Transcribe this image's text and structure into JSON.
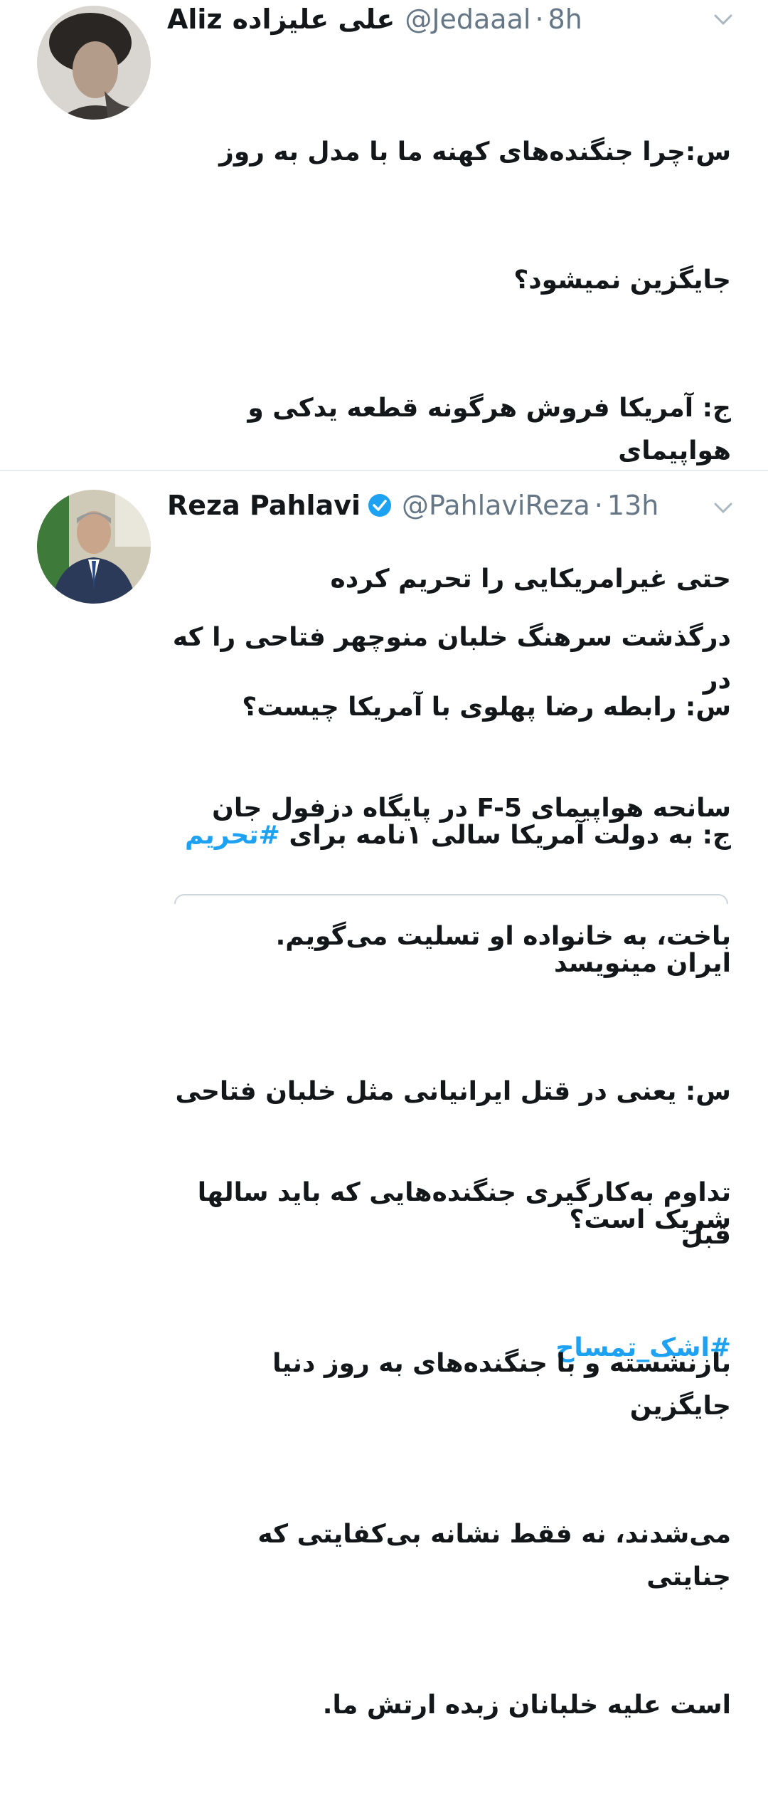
{
  "tweets": [
    {
      "display_name": "Aliz",
      "display_name_rtl": "علی علیزاده",
      "handle": "@Jedaaal",
      "separator": "·",
      "time": "8h",
      "avatar_icon": "person-avatar",
      "lines": [
        "س:چرا جنگنده‌های کهنه ما با مدل به روز",
        "جایگزین نمیشود؟",
        "ج: آمریکا فروش هرگونه قطعه یدکی و هواپیمای",
        "حتی غیرامریکایی را تحریم کرده",
        "س: رابطه رضا پهلوی با آمریکا چیست؟",
        "ج: به دولت آمریکا سالی ۱نامه برای",
        "ایران مینویسد",
        "س: یعنی در قتل ایرانیانی مثل خلبان فتاحی",
        "شریک است؟"
      ],
      "inline_hashtag": "#تحریم",
      "hashtag": "#اشک_تمساح"
    },
    {
      "display_name": "Reza Pahlavi",
      "handle": "@PahlaviReza",
      "separator": "·",
      "time": "13h",
      "verified": true,
      "avatar_icon": "person-avatar",
      "lines": [
        "درگذشت سرهنگ خلبان منوچهر فتاحی را که در",
        "سانحه هواپیمای F-5 در پایگاه دزفول جان",
        "باخت، به خانواده او تسلیت می‌گویم.",
        "تداوم به‌کارگیری جنگنده‌هایی که باید سالها قبل",
        "بازنشسته و با جنگنده‌های به روز دنیا جایگزین",
        "می‌شدند، نه فقط نشانه بی‌کفایتی که جنایتی",
        "است علیه خلبانان زبده ارتش ما."
      ]
    }
  ],
  "colors": {
    "link": "#1da1f2",
    "muted": "#657786",
    "divider": "#e6ecf0"
  }
}
